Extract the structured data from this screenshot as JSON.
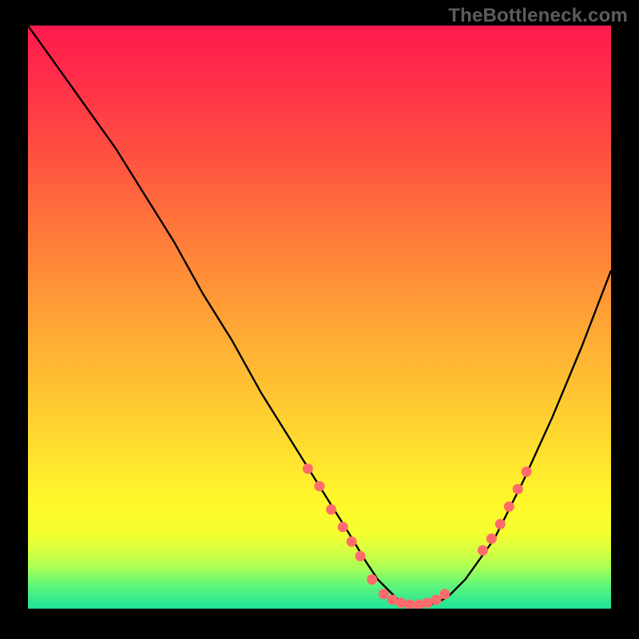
{
  "watermark": "TheBottleneck.com",
  "chart_data": {
    "type": "line",
    "title": "",
    "xlabel": "",
    "ylabel": "",
    "xlim": [
      0,
      100
    ],
    "ylim": [
      0,
      100
    ],
    "series": [
      {
        "name": "bottleneck-curve",
        "x": [
          0,
          5,
          10,
          15,
          20,
          25,
          30,
          35,
          40,
          45,
          50,
          55,
          58,
          60,
          62,
          64,
          66,
          68,
          70,
          72,
          75,
          80,
          85,
          90,
          95,
          100
        ],
        "y": [
          100,
          93,
          86,
          79,
          71,
          63,
          54,
          46,
          37,
          29,
          21,
          13,
          8,
          5,
          3,
          1,
          0.5,
          0.5,
          1,
          2,
          5,
          12,
          22,
          33,
          45,
          58
        ]
      }
    ],
    "markers": {
      "name": "highlight-dots",
      "color": "#ff6b6b",
      "points": [
        {
          "x": 48,
          "y": 24
        },
        {
          "x": 50,
          "y": 21
        },
        {
          "x": 52,
          "y": 17
        },
        {
          "x": 54,
          "y": 14
        },
        {
          "x": 55.5,
          "y": 11.5
        },
        {
          "x": 57,
          "y": 9
        },
        {
          "x": 59,
          "y": 5
        },
        {
          "x": 61,
          "y": 2.5
        },
        {
          "x": 62.5,
          "y": 1.5
        },
        {
          "x": 64,
          "y": 1
        },
        {
          "x": 65.5,
          "y": 0.7
        },
        {
          "x": 67,
          "y": 0.7
        },
        {
          "x": 68.5,
          "y": 1
        },
        {
          "x": 70,
          "y": 1.5
        },
        {
          "x": 71.5,
          "y": 2.5
        },
        {
          "x": 78,
          "y": 10
        },
        {
          "x": 79.5,
          "y": 12
        },
        {
          "x": 81,
          "y": 14.5
        },
        {
          "x": 82.5,
          "y": 17.5
        },
        {
          "x": 84,
          "y": 20.5
        },
        {
          "x": 85.5,
          "y": 23.5
        }
      ]
    }
  }
}
